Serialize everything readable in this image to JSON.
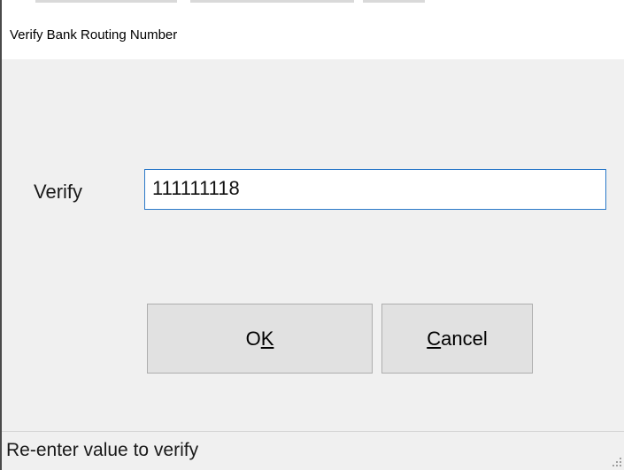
{
  "window": {
    "title": "Verify Bank Routing Number"
  },
  "form": {
    "verify_label": "Verify",
    "verify_value": "111111118"
  },
  "buttons": {
    "ok_label_before": "O",
    "ok_accel": "K",
    "ok_label_after": "",
    "cancel_accel": "C",
    "cancel_label_after": "ancel"
  },
  "statusbar": {
    "text": "Re-enter value to verify"
  },
  "colors": {
    "focus_border": "#2b79c9",
    "dialog_bg": "#f0f0f0",
    "button_bg": "#e1e1e1"
  }
}
